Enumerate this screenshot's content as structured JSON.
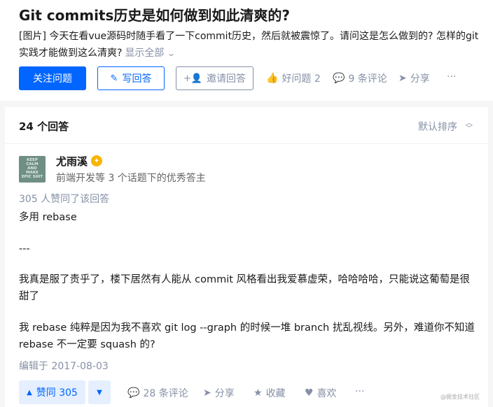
{
  "question": {
    "title": "Git commits历史是如何做到如此清爽的?",
    "excerpt": "[图片] 今天在看vue源码时随手看了一下commit历史，然后就被震惊了。请问这是怎么做到的? 怎样的git实践才能做到这么清爽?",
    "show_all": "显示全部",
    "buttons": {
      "follow": "关注问题",
      "write": "写回答",
      "invite": "邀请回答"
    },
    "actions": {
      "good_question": "好问题 2",
      "comments": "9 条评论",
      "share": "分享",
      "more": "···"
    }
  },
  "answers_header": {
    "count": "24 个回答",
    "sort": "默认排序"
  },
  "answer": {
    "avatar_text": [
      "KEEP",
      "CALM",
      "AND",
      "MAKE",
      "EPIC SHIT"
    ],
    "author_name": "尤雨溪",
    "author_desc": "前端开发等 3 个话题下的优秀答主",
    "votes_note": "305 人赞同了该回答",
    "paragraphs": [
      "多用 rebase",
      "---",
      "我真是服了责乎了，楼下居然有人能从 commit 风格看出我爱慕虚荣，哈哈哈哈，只能说这葡萄是很甜了",
      "我 rebase 纯粹是因为我不喜欢 git log --graph 的时候一堆 branch 扰乱视线。另外，难道你不知道 rebase 不一定要 squash 的?"
    ],
    "edit_date": "编辑于 2017-08-03",
    "vote_label": "赞同 305",
    "actions": {
      "comments": "28 条评论",
      "share": "分享",
      "collect": "收藏",
      "like": "喜欢",
      "more": "···"
    }
  },
  "watermark": "@掘金技术社区",
  "colors": {
    "brand_blue": "#0066ff",
    "muted": "#8590a6",
    "badge": "#f7b500"
  }
}
